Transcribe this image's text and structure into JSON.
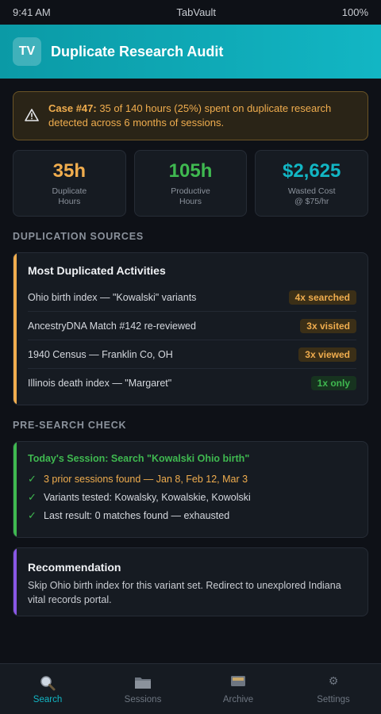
{
  "status_bar": {
    "time": "9:41 AM",
    "carrier": "TabVault",
    "battery": "100%"
  },
  "header": {
    "logo": "TV",
    "title": "Duplicate Research Audit"
  },
  "alert": {
    "icon": "warning-triangle-icon",
    "case_label": "Case #47:",
    "message": " 35 of 140 hours (25%) spent on duplicate research detected across 6 months of sessions."
  },
  "stats": [
    {
      "value": "35h",
      "label": "Duplicate\nHours",
      "color": "#f0ad4e"
    },
    {
      "value": "105h",
      "label": "Productive\nHours",
      "color": "#3fb950"
    },
    {
      "value": "$2,625",
      "label": "Wasted Cost\n@ $75/hr",
      "color": "#12b6c4"
    }
  ],
  "duplication": {
    "section_title": "DUPLICATION SOURCES",
    "heading": "Most Duplicated Activities",
    "accent": "#f0ad4e",
    "rows": [
      {
        "label": "Ohio birth index — \"Kowalski\" variants",
        "badge": "4x searched",
        "status": "warn"
      },
      {
        "label": "AncestryDNA Match #142 re-reviewed",
        "badge": "3x visited",
        "status": "warn"
      },
      {
        "label": "1940 Census — Franklin Co, OH",
        "badge": "3x viewed",
        "status": "warn"
      },
      {
        "label": "Illinois death index — \"Margaret\"",
        "badge": "1x only",
        "status": "ok"
      }
    ]
  },
  "pre_search": {
    "section_title": "PRE-SEARCH CHECK",
    "heading": "Today's Session: Search \"Kowalski Ohio birth\"",
    "accent": "#3fb950",
    "checks": [
      "3 prior sessions found — Jan 8, Feb 12, Mar 3",
      "Variants tested: Kowalsky, Kowalskie, Kowolski",
      "Last result: 0 matches found — exhausted"
    ]
  },
  "recommendation": {
    "heading": "Recommendation",
    "text": "Skip Ohio birth index for this variant set. Redirect to unexplored Indiana vital records portal.",
    "accent": "#8957e5"
  },
  "nav": [
    {
      "label": "Search",
      "icon": "magnifier-icon",
      "active": true
    },
    {
      "label": "Sessions",
      "icon": "folder-icon",
      "active": false
    },
    {
      "label": "Archive",
      "icon": "card-box-icon",
      "active": false
    },
    {
      "label": "Settings",
      "icon": "gear-icon",
      "active": false
    }
  ]
}
